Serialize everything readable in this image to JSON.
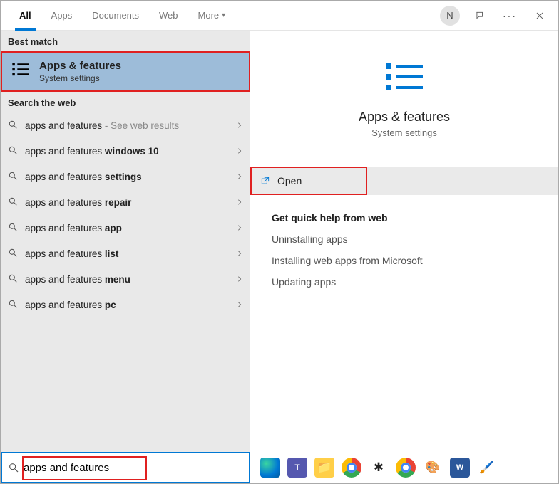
{
  "tabs": {
    "all": "All",
    "apps": "Apps",
    "documents": "Documents",
    "web": "Web",
    "more": "More"
  },
  "avatar_initial": "N",
  "left": {
    "best_match_label": "Best match",
    "best_match": {
      "title": "Apps & features",
      "subtitle": "System settings"
    },
    "search_web_label": "Search the web",
    "items": [
      {
        "prefix": "apps and features",
        "bold": "",
        "suffix": " - See web results"
      },
      {
        "prefix": "apps and features ",
        "bold": "windows 10",
        "suffix": ""
      },
      {
        "prefix": "apps and features ",
        "bold": "settings",
        "suffix": ""
      },
      {
        "prefix": "apps and features ",
        "bold": "repair",
        "suffix": ""
      },
      {
        "prefix": "apps and features ",
        "bold": "app",
        "suffix": ""
      },
      {
        "prefix": "apps and features ",
        "bold": "list",
        "suffix": ""
      },
      {
        "prefix": "apps and features ",
        "bold": "menu",
        "suffix": ""
      },
      {
        "prefix": "apps and features ",
        "bold": "pc",
        "suffix": ""
      }
    ]
  },
  "right": {
    "title": "Apps & features",
    "subtitle": "System settings",
    "open_label": "Open",
    "help_title": "Get quick help from web",
    "help_links": [
      "Uninstalling apps",
      "Installing web apps from Microsoft",
      "Updating apps"
    ]
  },
  "search_value": "apps and features",
  "taskbar_icons": [
    "edge",
    "teams",
    "explorer",
    "chrome",
    "slack",
    "chrome",
    "snagit",
    "word",
    "paint"
  ]
}
